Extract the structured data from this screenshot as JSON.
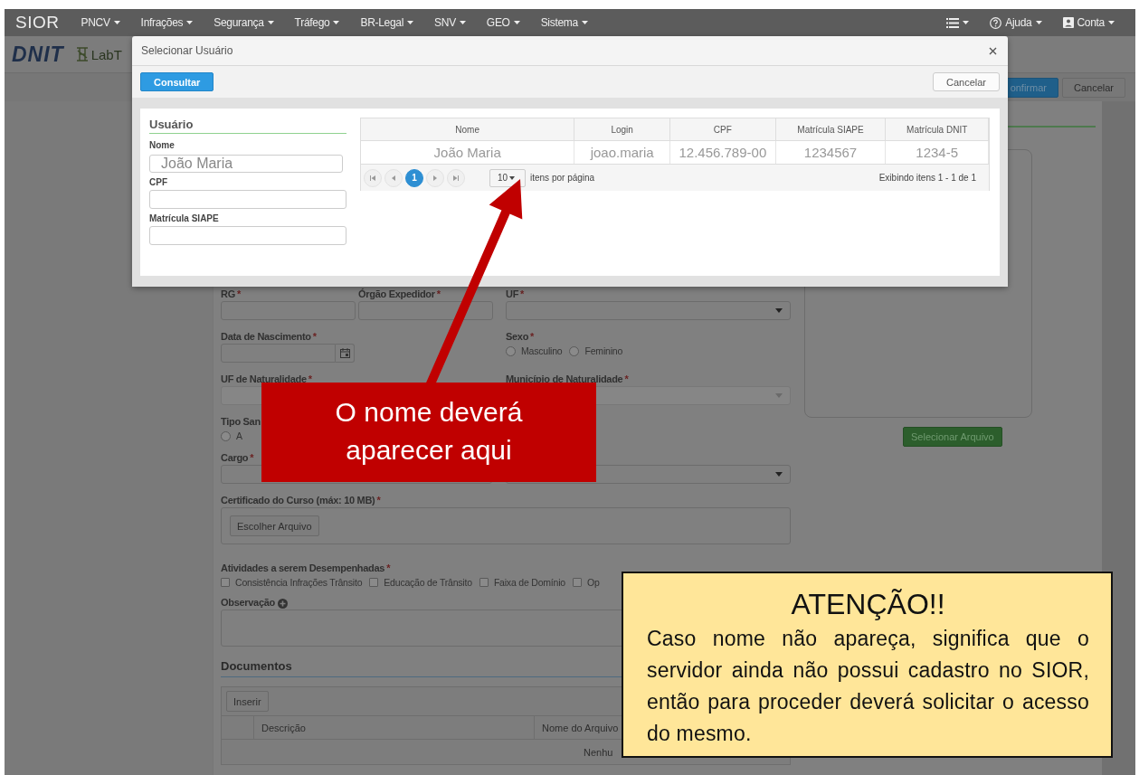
{
  "navbar": {
    "logo": "SIOR",
    "menus": [
      "PNCV",
      "Infrações",
      "Segurança",
      "Tráfego",
      "BR-Legal",
      "SNV",
      "GEO",
      "Sistema"
    ],
    "help": "Ajuda",
    "account": "Conta"
  },
  "header": {
    "logo": "DNIT",
    "lab_logo": "LabT"
  },
  "page_actions": [
    {
      "label": "onfirmar",
      "kind": "primary"
    },
    {
      "label": "Cancelar",
      "kind": "default"
    }
  ],
  "form": {
    "row1": [
      {
        "label": "RG",
        "marker": "*",
        "kind": "input"
      },
      {
        "label": "Órgão Expedidor",
        "marker": "*",
        "kind": "input"
      },
      {
        "label": "UF",
        "marker": "*",
        "kind": "select",
        "disabled": false
      }
    ],
    "birth": {
      "label": "Data de Nascimento",
      "marker": "*"
    },
    "sex": {
      "label": "Sexo",
      "marker": "*",
      "options": [
        {
          "label": "Masculino",
          "selected": false
        },
        {
          "label": "Feminino",
          "selected": false
        }
      ]
    },
    "row3": [
      {
        "label": "UF de Naturalidade",
        "marker": "*",
        "disabled": true
      },
      {
        "label": "Município de Naturalidade",
        "marker": "*",
        "disabled": true
      }
    ],
    "blood": {
      "label": "Tipo San",
      "options": [
        {
          "label": "A",
          "selected": false
        }
      ]
    },
    "cargo": {
      "label": "Cargo",
      "marker": "*"
    },
    "cargo_side_select": {
      "disabled": false
    },
    "certificate": {
      "label": "Certificado do Curso (máx: 10 MB)",
      "marker": "*",
      "button": "Escolher Arquivo"
    },
    "activities": {
      "label": "Atividades a serem Desempenhadas",
      "marker": "*",
      "options": [
        {
          "label": "Consistência Infrações Trânsito",
          "checked": false
        },
        {
          "label": "Educação de Trânsito",
          "checked": false
        },
        {
          "label": "Faixa de Domínio",
          "checked": false
        },
        {
          "label": "Op",
          "checked": false
        }
      ]
    },
    "observation": {
      "label": "Observação"
    },
    "documents": {
      "title": "Documentos",
      "insert_button": "Inserir",
      "columns": [
        "Descrição",
        "Nome do Arquivo"
      ],
      "empty_text": "Nenhu"
    },
    "photo_button": "Selecionar Arquivo"
  },
  "modal": {
    "title": "Selecionar Usuário",
    "search_button": "Consultar",
    "cancel_button": "Cancelar",
    "filter": {
      "title": "Usuário",
      "fields": [
        {
          "label": "Nome",
          "value": "João Maria"
        },
        {
          "label": "CPF"
        },
        {
          "label": "Matrícula SIAPE"
        }
      ]
    },
    "table": {
      "columns": [
        "Nome",
        "Login",
        "CPF",
        "Matrícula SIAPE",
        "Matrícula DNIT"
      ],
      "rows": [
        [
          "João Maria",
          "joao.maria",
          "12.456.789-00",
          "1234567",
          "1234-5"
        ]
      ]
    },
    "pager": {
      "pages": [
        {
          "label": "1",
          "selected": true
        }
      ],
      "page_size": "10",
      "page_size_label": "itens por página",
      "summary": "Exibindo itens 1 - 1 de 1"
    }
  },
  "callout": {
    "text": "O nome deverá aparecer aqui"
  },
  "notice": {
    "title": "ATENÇÃO!!",
    "text": "Caso nome não apareça, significa que o servidor ainda não possui cadastro no SIOR, então para proceder deverá solicitar o acesso do mesmo."
  }
}
